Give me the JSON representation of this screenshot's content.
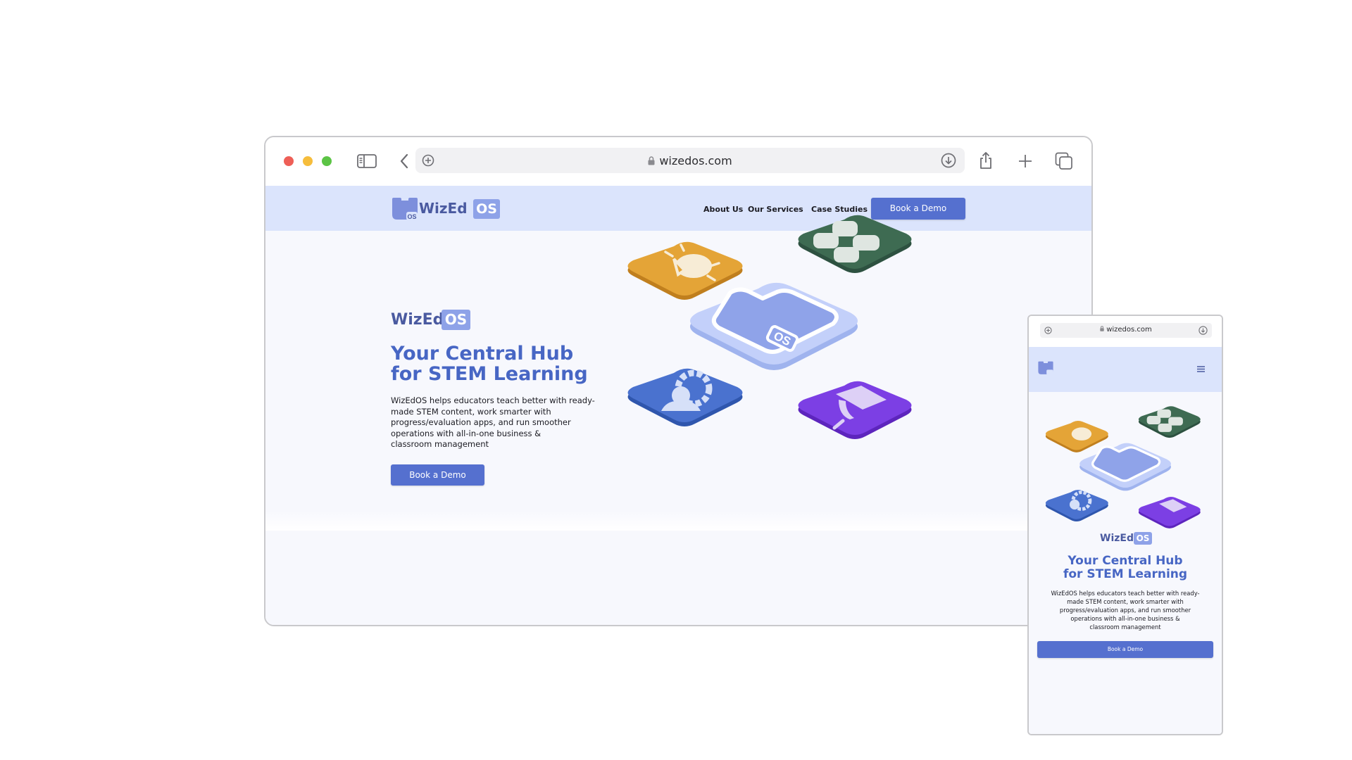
{
  "browser": {
    "url": "wizedos.com",
    "icons": [
      "sidebar-icon",
      "back-icon",
      "site-settings-icon",
      "lock-icon",
      "download-icon",
      "share-icon",
      "new-tab-icon",
      "tab-overview-icon"
    ]
  },
  "site": {
    "logo": {
      "word": "WizEd",
      "chip": "OS",
      "mark_text": "OS"
    },
    "nav": [
      {
        "label": "About Us"
      },
      {
        "label": "Our Services"
      },
      {
        "label": "Case Studies"
      }
    ],
    "cta_label": "Book a Demo",
    "hero": {
      "brand_word": "WizEd",
      "brand_chip": "OS",
      "title_line1": "Your Central Hub",
      "title_line2": "for STEM Learning",
      "description_lines": [
        "WizEdOS helps educators teach better with ready-",
        "made STEM content, work smarter with",
        "progress/evaluation apps, and run smoother",
        "operations with all-in-one business &",
        "classroom management"
      ],
      "button_label": "Book a Demo"
    },
    "illustration": {
      "center_label": "OS",
      "tiles": [
        {
          "name": "lightbulb-tile",
          "color": "#e4a437"
        },
        {
          "name": "apps-grid-tile",
          "color": "#3e6b52"
        },
        {
          "name": "user-gear-tile",
          "color": "#4a72cf"
        },
        {
          "name": "graduation-cap-tile",
          "color": "#7c3fe4"
        }
      ],
      "center_color": "#c3d0fa"
    }
  },
  "mobile": {
    "url": "wizedos.com",
    "menu_icon": "hamburger-menu-icon",
    "brand_word": "WizEd",
    "brand_chip": "OS",
    "title_line1": "Your Central Hub",
    "title_line2": "for STEM Learning",
    "description_lines": [
      "WizEdOS helps educators teach better with ready-",
      "made STEM content, work smarter with",
      "progress/evaluation apps, and run smoother",
      "operations with all-in-one business &",
      "classroom management"
    ],
    "button_label": "Book a Demo"
  },
  "colors": {
    "accent": "#5570cf",
    "title": "#4766c4",
    "header_bg": "#dbe4fc",
    "page_bg": "#f7f8fd"
  }
}
